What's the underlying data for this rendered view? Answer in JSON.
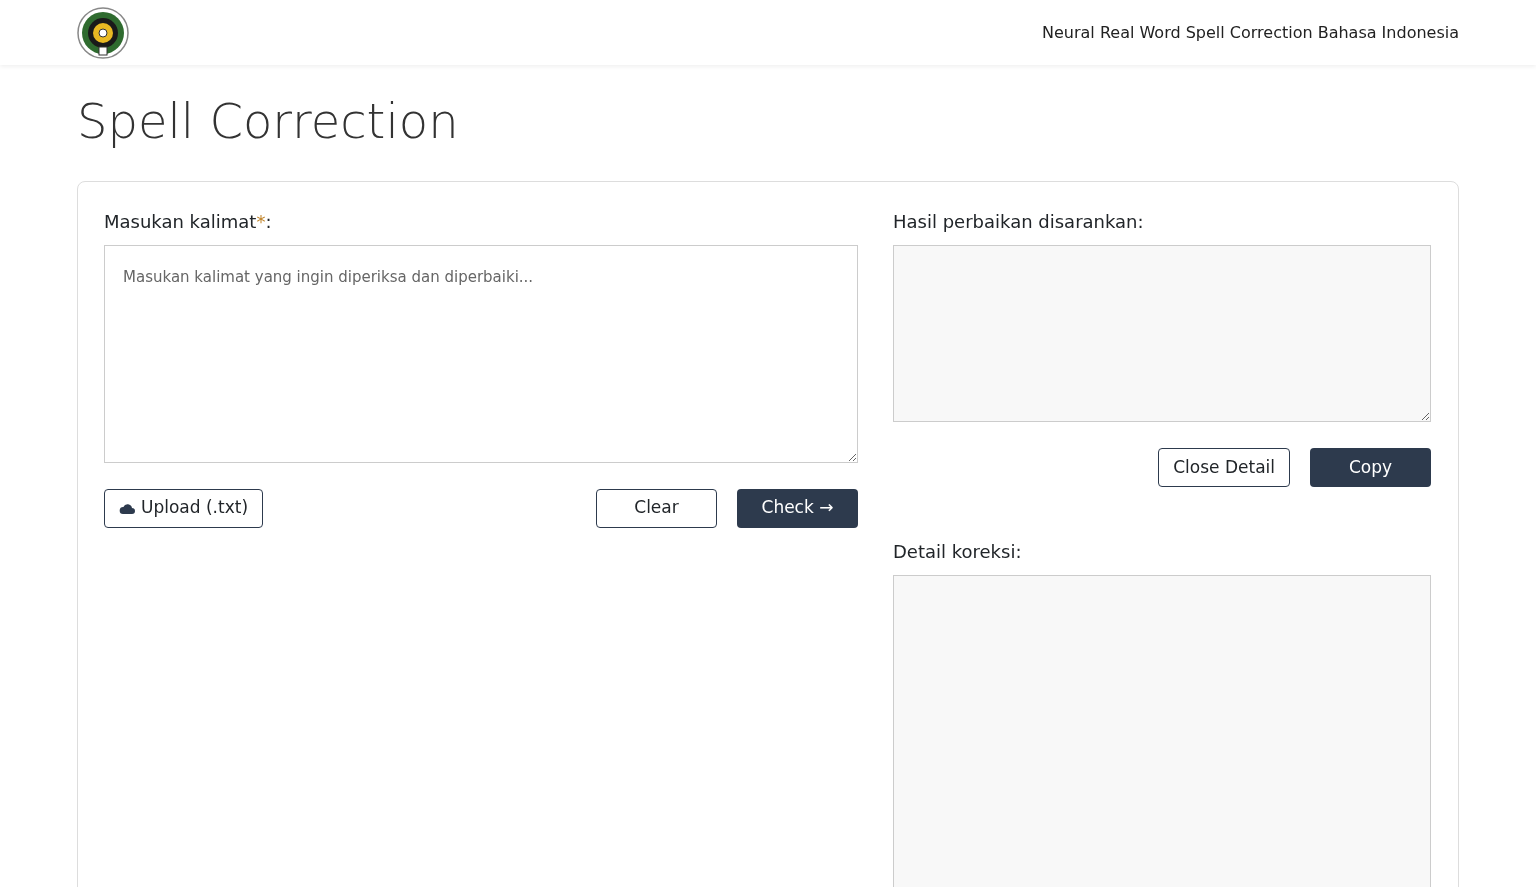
{
  "navbar": {
    "title": "Neural Real Word Spell Correction Bahasa Indonesia"
  },
  "page_title": "Spell Correction",
  "input": {
    "label": "Masukan kalimat",
    "required_mark": "*",
    "label_suffix": ":",
    "placeholder": "Masukan kalimat yang ingin diperiksa dan diperbaiki..."
  },
  "input_buttons": [
    {
      "label": "Upload (.txt)",
      "kind": "upload"
    },
    {
      "label": "Clear",
      "kind": "outline"
    },
    {
      "label": "Check →",
      "kind": "primary"
    }
  ],
  "output": {
    "label": "Hasil perbaikan disarankan:"
  },
  "output_buttons": [
    {
      "label": "Close Detail",
      "kind": "outline"
    },
    {
      "label": "Copy",
      "kind": "primary"
    }
  ],
  "detail": {
    "label": "Detail koreksi:"
  }
}
